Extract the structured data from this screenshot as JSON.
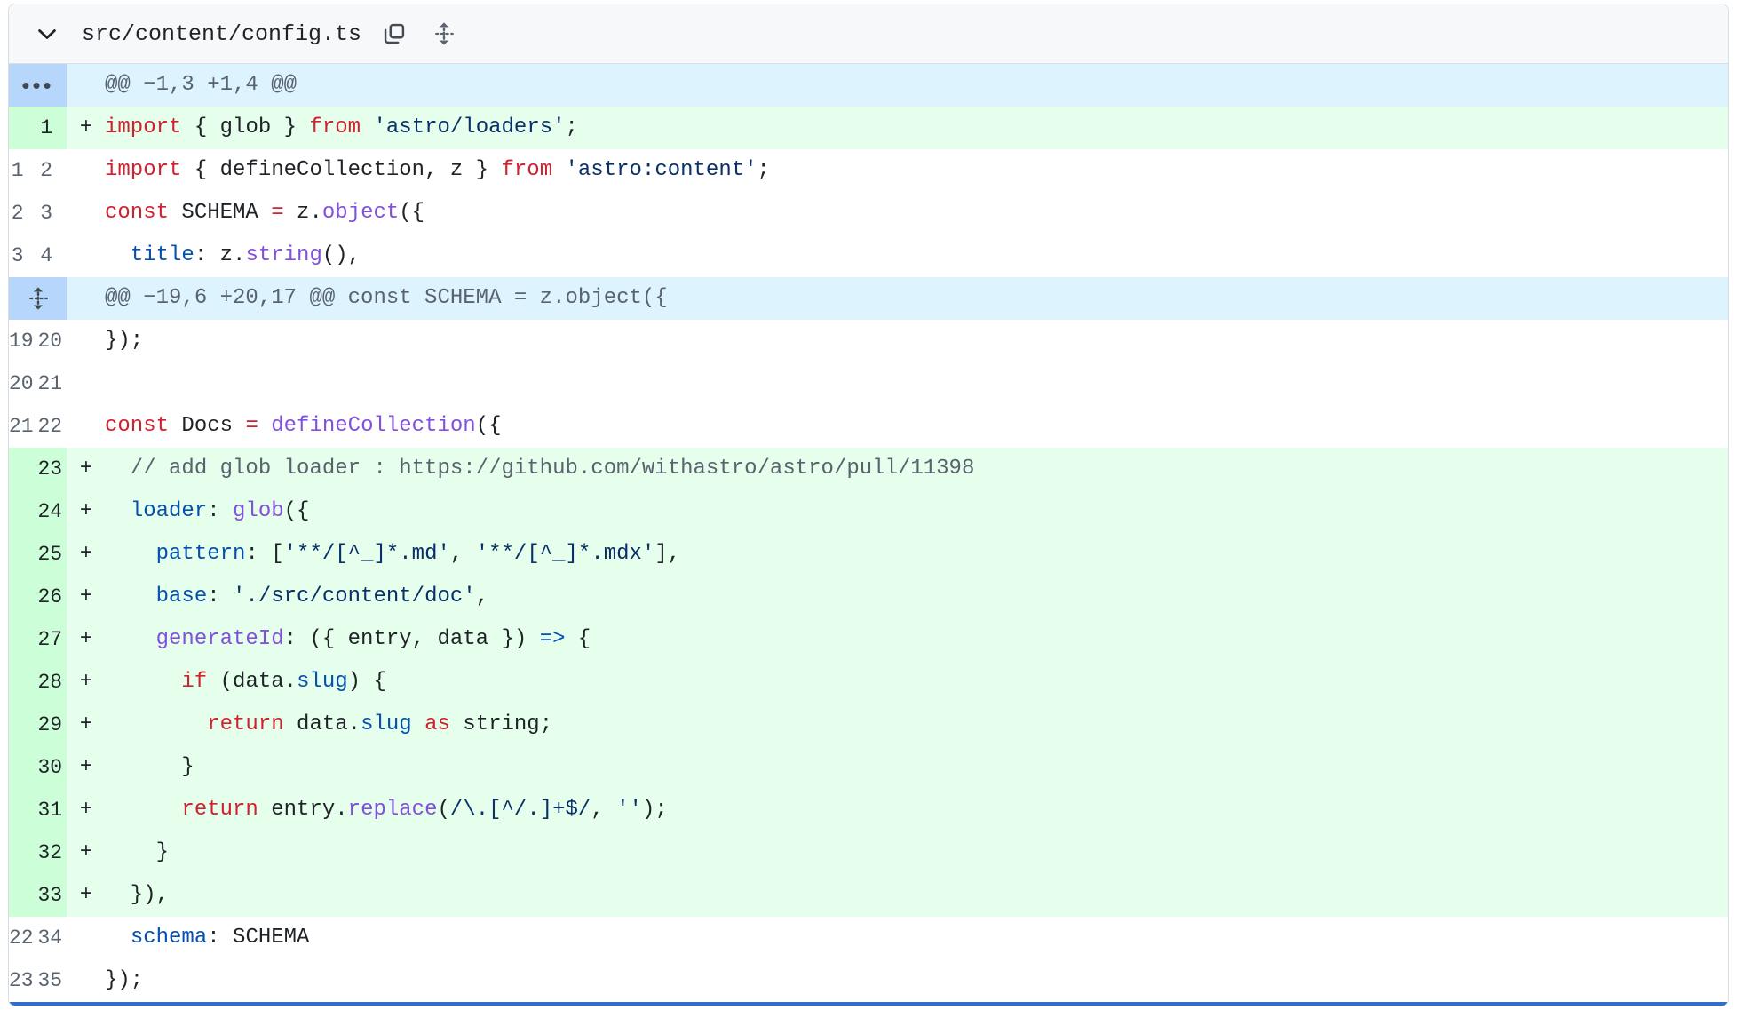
{
  "header": {
    "file_path": "src/content/config.ts",
    "chevron_icon": "chevron-down-icon",
    "copy_icon": "copy-path-icon",
    "move_icon": "expand-up-down-icon"
  },
  "diff": {
    "rows": [
      {
        "kind": "hunk",
        "gutter": "dots",
        "marker": "",
        "segments": [
          {
            "t": "@@ −1,3 +1,4 @@",
            "c": "c"
          }
        ]
      },
      {
        "kind": "add",
        "left": "",
        "right": "1",
        "marker": "+",
        "segments": [
          {
            "t": "import",
            "c": "k"
          },
          {
            "t": " { ",
            "c": "p"
          },
          {
            "t": "glob",
            "c": "p"
          },
          {
            "t": " } ",
            "c": "p"
          },
          {
            "t": "from",
            "c": "k"
          },
          {
            "t": " ",
            "c": "p"
          },
          {
            "t": "'astro/loaders'",
            "c": "s"
          },
          {
            "t": ";",
            "c": "p"
          }
        ]
      },
      {
        "kind": "ctx",
        "left": "1",
        "right": "2",
        "marker": "",
        "segments": [
          {
            "t": "import",
            "c": "k"
          },
          {
            "t": " { defineCollection, z } ",
            "c": "p"
          },
          {
            "t": "from",
            "c": "k"
          },
          {
            "t": " ",
            "c": "p"
          },
          {
            "t": "'astro:content'",
            "c": "s"
          },
          {
            "t": ";",
            "c": "p"
          }
        ]
      },
      {
        "kind": "ctx",
        "left": "2",
        "right": "3",
        "marker": "",
        "segments": [
          {
            "t": "const",
            "c": "k"
          },
          {
            "t": " SCHEMA ",
            "c": "p"
          },
          {
            "t": "=",
            "c": "k"
          },
          {
            "t": " z.",
            "c": "p"
          },
          {
            "t": "object",
            "c": "e"
          },
          {
            "t": "({",
            "c": "p"
          }
        ]
      },
      {
        "kind": "ctx",
        "left": "3",
        "right": "4",
        "marker": "",
        "segments": [
          {
            "t": "  ",
            "c": "p"
          },
          {
            "t": "title",
            "c": "v"
          },
          {
            "t": ": z.",
            "c": "p"
          },
          {
            "t": "string",
            "c": "e"
          },
          {
            "t": "(),",
            "c": "p"
          }
        ]
      },
      {
        "kind": "hunk",
        "gutter": "expand",
        "marker": "",
        "segments": [
          {
            "t": "@@ −19,6 +20,17 @@ const SCHEMA = z.object({",
            "c": "c"
          }
        ]
      },
      {
        "kind": "ctx",
        "left": "19",
        "right": "20",
        "marker": "",
        "segments": [
          {
            "t": "});",
            "c": "p"
          }
        ]
      },
      {
        "kind": "ctx",
        "left": "20",
        "right": "21",
        "marker": "",
        "segments": [
          {
            "t": "",
            "c": "p"
          }
        ]
      },
      {
        "kind": "ctx",
        "left": "21",
        "right": "22",
        "marker": "",
        "segments": [
          {
            "t": "const",
            "c": "k"
          },
          {
            "t": " Docs ",
            "c": "p"
          },
          {
            "t": "=",
            "c": "k"
          },
          {
            "t": " ",
            "c": "p"
          },
          {
            "t": "defineCollection",
            "c": "e"
          },
          {
            "t": "({",
            "c": "p"
          }
        ]
      },
      {
        "kind": "add",
        "left": "",
        "right": "23",
        "marker": "+",
        "segments": [
          {
            "t": "  // add glob loader : https://github.com/withastro/astro/pull/11398",
            "c": "c"
          }
        ]
      },
      {
        "kind": "add",
        "left": "",
        "right": "24",
        "marker": "+",
        "segments": [
          {
            "t": "  ",
            "c": "p"
          },
          {
            "t": "loader",
            "c": "v"
          },
          {
            "t": ": ",
            "c": "p"
          },
          {
            "t": "glob",
            "c": "e"
          },
          {
            "t": "({",
            "c": "p"
          }
        ]
      },
      {
        "kind": "add",
        "left": "",
        "right": "25",
        "marker": "+",
        "segments": [
          {
            "t": "    ",
            "c": "p"
          },
          {
            "t": "pattern",
            "c": "v"
          },
          {
            "t": ": [",
            "c": "p"
          },
          {
            "t": "'**/[^_]*.md'",
            "c": "s"
          },
          {
            "t": ", ",
            "c": "p"
          },
          {
            "t": "'**/[^_]*.mdx'",
            "c": "s"
          },
          {
            "t": "],",
            "c": "p"
          }
        ]
      },
      {
        "kind": "add",
        "left": "",
        "right": "26",
        "marker": "+",
        "segments": [
          {
            "t": "    ",
            "c": "p"
          },
          {
            "t": "base",
            "c": "v"
          },
          {
            "t": ": ",
            "c": "p"
          },
          {
            "t": "'./src/content/doc'",
            "c": "s"
          },
          {
            "t": ",",
            "c": "p"
          }
        ]
      },
      {
        "kind": "add",
        "left": "",
        "right": "27",
        "marker": "+",
        "segments": [
          {
            "t": "    ",
            "c": "p"
          },
          {
            "t": "generateId",
            "c": "e"
          },
          {
            "t": ": ({ entry, data }) ",
            "c": "p"
          },
          {
            "t": "=>",
            "c": "op"
          },
          {
            "t": " {",
            "c": "p"
          }
        ]
      },
      {
        "kind": "add",
        "left": "",
        "right": "28",
        "marker": "+",
        "segments": [
          {
            "t": "      ",
            "c": "p"
          },
          {
            "t": "if",
            "c": "k"
          },
          {
            "t": " (data.",
            "c": "p"
          },
          {
            "t": "slug",
            "c": "v"
          },
          {
            "t": ") {",
            "c": "p"
          }
        ]
      },
      {
        "kind": "add",
        "left": "",
        "right": "29",
        "marker": "+",
        "segments": [
          {
            "t": "        ",
            "c": "p"
          },
          {
            "t": "return",
            "c": "k"
          },
          {
            "t": " data.",
            "c": "p"
          },
          {
            "t": "slug",
            "c": "v"
          },
          {
            "t": " ",
            "c": "p"
          },
          {
            "t": "as",
            "c": "k"
          },
          {
            "t": " string;",
            "c": "p"
          }
        ]
      },
      {
        "kind": "add",
        "left": "",
        "right": "30",
        "marker": "+",
        "segments": [
          {
            "t": "      }",
            "c": "p"
          }
        ]
      },
      {
        "kind": "add",
        "left": "",
        "right": "31",
        "marker": "+",
        "segments": [
          {
            "t": "      ",
            "c": "p"
          },
          {
            "t": "return",
            "c": "k"
          },
          {
            "t": " entry.",
            "c": "p"
          },
          {
            "t": "replace",
            "c": "e"
          },
          {
            "t": "(",
            "c": "p"
          },
          {
            "t": "/\\.[^/.]+$/",
            "c": "rgx"
          },
          {
            "t": ", ",
            "c": "p"
          },
          {
            "t": "''",
            "c": "s"
          },
          {
            "t": ");",
            "c": "p"
          }
        ]
      },
      {
        "kind": "add",
        "left": "",
        "right": "32",
        "marker": "+",
        "segments": [
          {
            "t": "    }",
            "c": "p"
          }
        ]
      },
      {
        "kind": "add",
        "left": "",
        "right": "33",
        "marker": "+",
        "segments": [
          {
            "t": "  }),",
            "c": "p"
          }
        ]
      },
      {
        "kind": "ctx",
        "left": "22",
        "right": "34",
        "marker": "",
        "segments": [
          {
            "t": "  ",
            "c": "p"
          },
          {
            "t": "schema",
            "c": "v"
          },
          {
            "t": ": SCHEMA",
            "c": "p"
          }
        ]
      },
      {
        "kind": "ctx",
        "left": "23",
        "right": "35",
        "marker": "",
        "segments": [
          {
            "t": "});",
            "c": "p"
          }
        ]
      }
    ]
  },
  "colors": {
    "added_bg": "#e6ffec",
    "added_gutter_bg": "#ccffd8",
    "hunk_bg": "#ddf4ff",
    "hunk_gutter_bg": "#b6d7fb",
    "border": "#d8dee4",
    "header_bg": "#f6f8fa",
    "keyword": "#cf222e",
    "string": "#0a3069",
    "entity": "#8250df",
    "variable": "#0550ae",
    "comment": "#59636e",
    "focus_rule": "#316dca"
  }
}
